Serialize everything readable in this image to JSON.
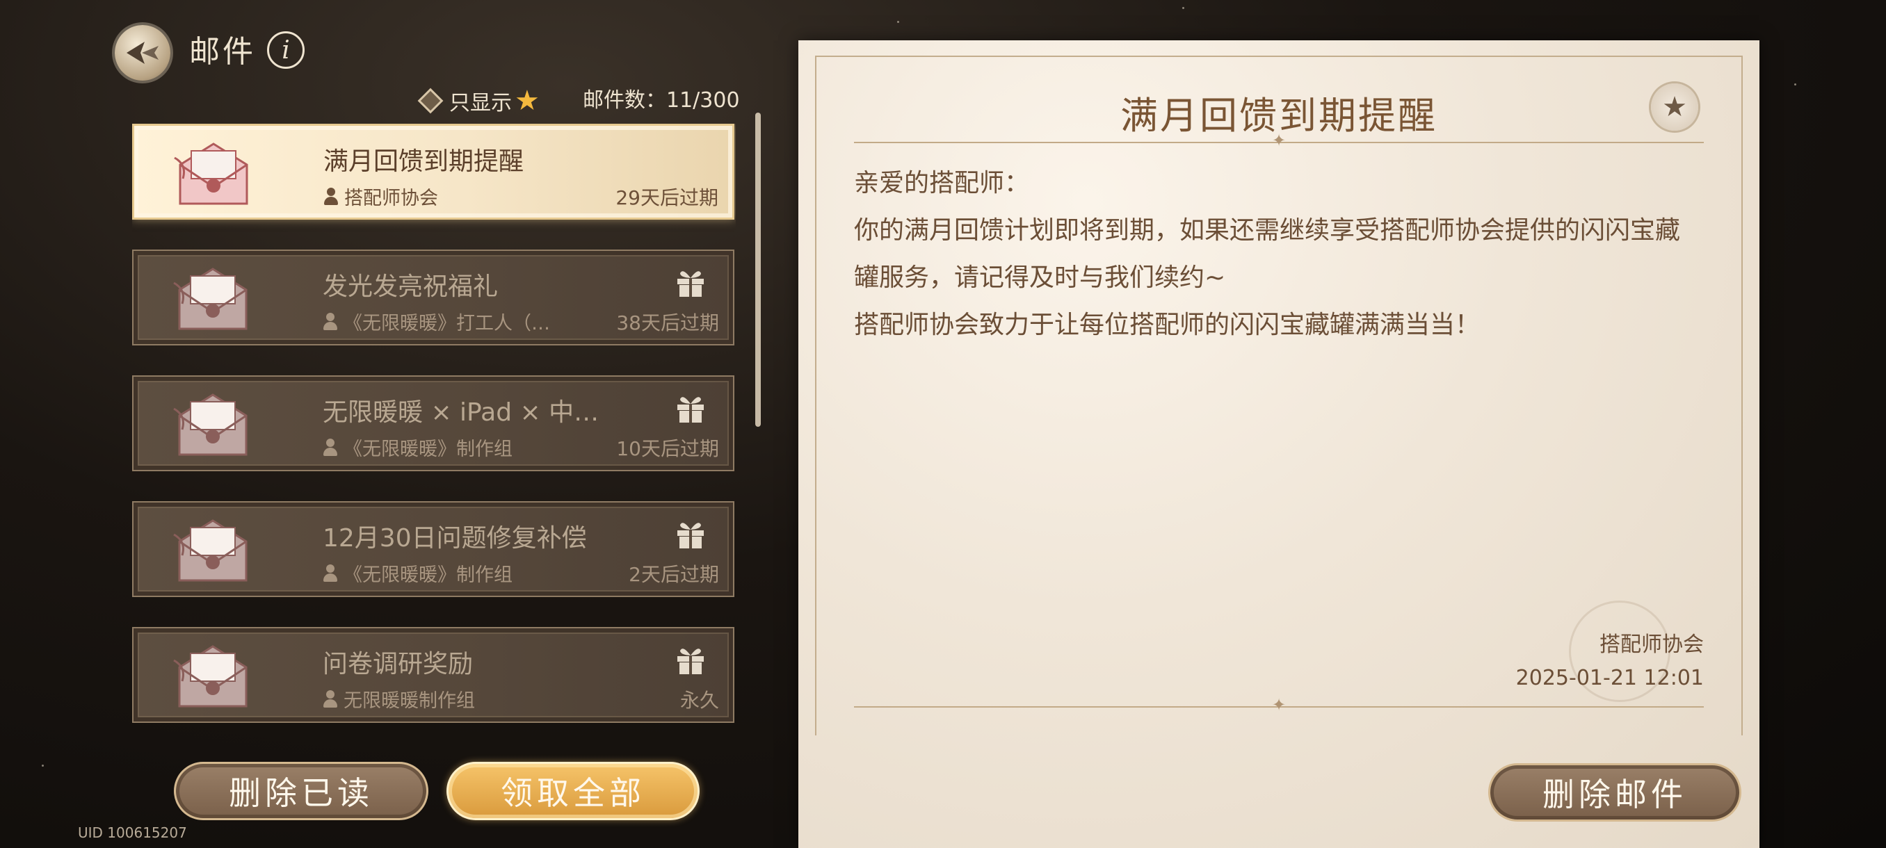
{
  "header": {
    "title": "邮件",
    "info_icon": "i"
  },
  "filter": {
    "label": "只显示",
    "icon": "star-icon"
  },
  "mail_count": "邮件数：11/300",
  "mails": [
    {
      "title": "满月回馈到期提醒",
      "sender": "搭配师协会",
      "expire": "29天后过期",
      "active": true,
      "has_gift": false
    },
    {
      "title": "发光发亮祝福礼",
      "sender": "《无限暖暖》打工人（…",
      "expire": "38天后过期",
      "active": false,
      "has_gift": true
    },
    {
      "title": "无限暖暖 × iPad × 中…",
      "sender": "《无限暖暖》制作组",
      "expire": "10天后过期",
      "active": false,
      "has_gift": true
    },
    {
      "title": "12月30日问题修复补偿",
      "sender": "《无限暖暖》制作组",
      "expire": "2天后过期",
      "active": false,
      "has_gift": true
    },
    {
      "title": "问卷调研奖励",
      "sender": "无限暖暖制作组",
      "expire": "永久",
      "active": false,
      "has_gift": true
    }
  ],
  "buttons": {
    "delete_read": "删除已读",
    "claim_all": "领取全部",
    "delete_mail": "删除邮件"
  },
  "uid": "UID 100615207",
  "letter": {
    "title": "满月回馈到期提醒",
    "greeting": "亲爱的搭配师：",
    "body_1": "你的满月回馈计划即将到期，如果还需继续享受搭配师协会提供的闪闪宝藏罐服务，请记得及时与我们续约~",
    "body_2": "搭配师协会致力于让每位搭配师的闪闪宝藏罐满满当当！",
    "signature": "搭配师协会",
    "date": "2025-01-21 12:01"
  },
  "colors": {
    "accent_gold": "#f4b93e",
    "letter_text": "#6b4e36",
    "active_item": "#f6e6c8"
  }
}
